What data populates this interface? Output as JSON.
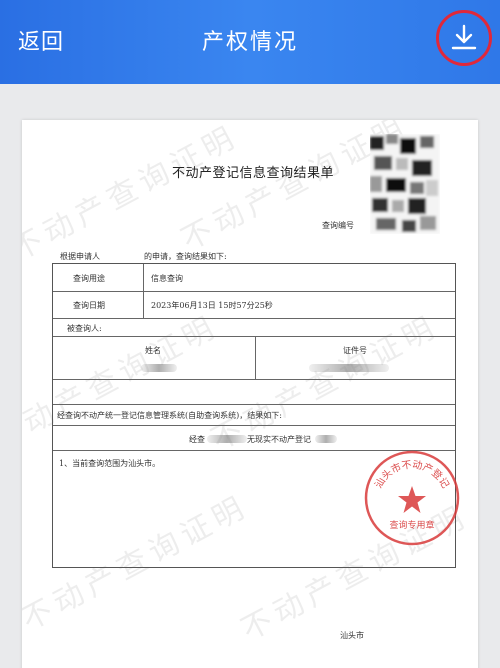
{
  "header": {
    "back_label": "返回",
    "title": "产权情况"
  },
  "watermark_text": "不动产查询证明",
  "document": {
    "title": "不动产登记信息查询结果单",
    "query_no_label": "查询编号",
    "intro_prefix": "根据申请人",
    "intro_suffix": "的申请，查询结果如下:",
    "rows": {
      "purpose_label": "查询用途",
      "purpose_value": "信息查询",
      "date_label": "查询日期",
      "date_value": "2023年06月13日 15时57分25秒",
      "queried_label": "被查询人:",
      "name_header": "姓名",
      "id_header": "证件号",
      "statement": "经查询不动产统一登记信息管理系统(自助查询系统)，结果如下:",
      "result_prefix": "经查",
      "result_text": "无现实不动产登记",
      "note": "1、当前查询范围为汕头市。"
    },
    "seal": {
      "top_text": "汕头市不动产登记",
      "bottom_text": "查询专用章"
    },
    "footer_city": "汕头市"
  },
  "colors": {
    "header_blue": "#2f7ae9",
    "highlight_red": "#e0283a",
    "seal_red": "#d83a3a"
  }
}
